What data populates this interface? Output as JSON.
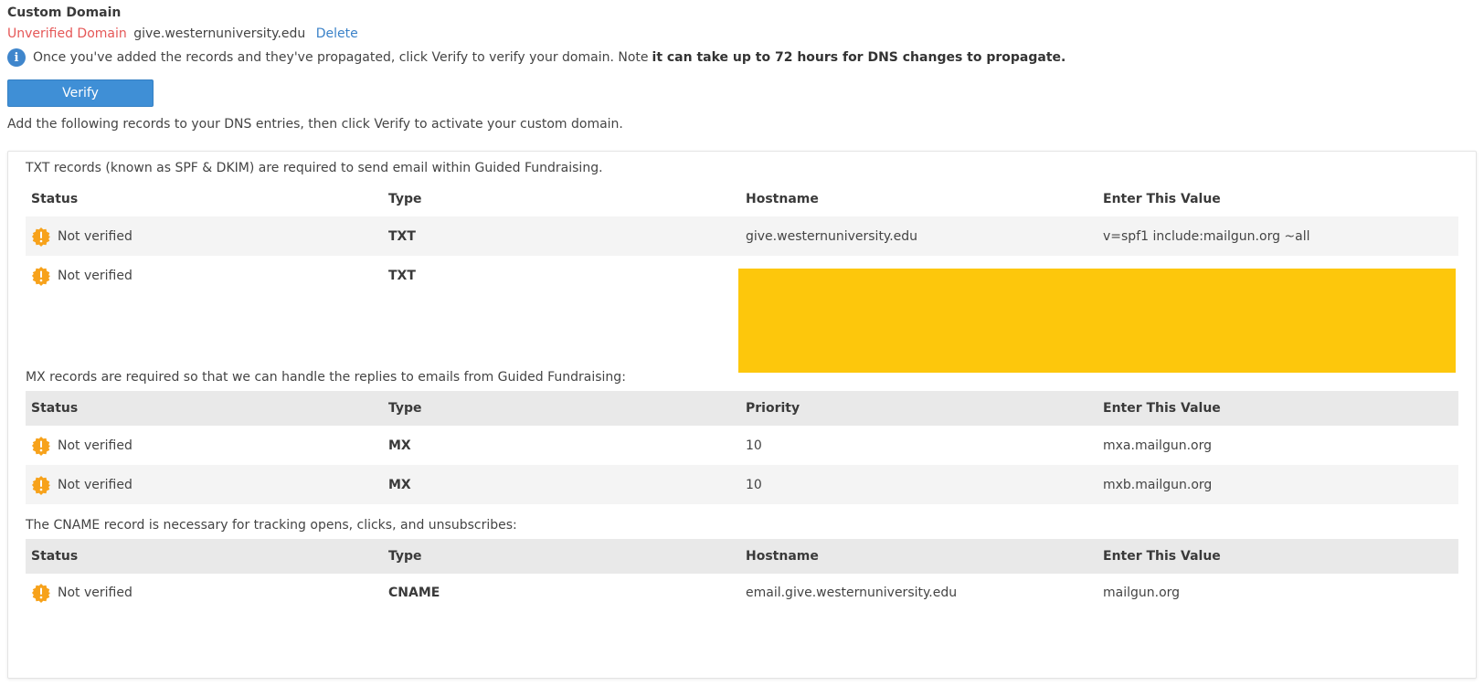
{
  "header": {
    "title": "Custom Domain",
    "status_label": "Unverified Domain",
    "domain": "give.westernuniversity.edu",
    "delete_label": "Delete"
  },
  "info": {
    "icon": "info-icon",
    "text": "Once you've added the records and they've propagated, click Verify to verify your domain. Note",
    "bold_text": "it can take up to 72 hours for DNS changes to propagate."
  },
  "verify_button": {
    "label": "Verify"
  },
  "instructions": "Add the following records to your DNS entries, then click Verify to activate your custom domain.",
  "colors": {
    "unverified": "#e55757",
    "link": "#3b82c8",
    "button": "#3f8fd6",
    "warning": "#f7a21b",
    "redaction": "#fdc70c"
  },
  "txt_section": {
    "note": "TXT records (known as SPF & DKIM) are required to send email within Guided Fundraising.",
    "headers": [
      "Status",
      "Type",
      "Hostname",
      "Enter This Value"
    ],
    "rows": [
      {
        "status": "Not verified",
        "type": "TXT",
        "hostname": "give.westernuniversity.edu",
        "value": "v=spf1 include:mailgun.org ~all"
      },
      {
        "status": "Not verified",
        "type": "TXT",
        "hostname": "",
        "value": ""
      }
    ]
  },
  "mx_section": {
    "note": "MX records are required so that we can handle the replies to emails from Guided Fundraising:",
    "headers": [
      "Status",
      "Type",
      "Priority",
      "Enter This Value"
    ],
    "rows": [
      {
        "status": "Not verified",
        "type": "MX",
        "priority": "10",
        "value": "mxa.mailgun.org"
      },
      {
        "status": "Not verified",
        "type": "MX",
        "priority": "10",
        "value": "mxb.mailgun.org"
      }
    ]
  },
  "cname_section": {
    "note": "The CNAME record is necessary for tracking opens, clicks, and unsubscribes:",
    "headers": [
      "Status",
      "Type",
      "Hostname",
      "Enter This Value"
    ],
    "rows": [
      {
        "status": "Not verified",
        "type": "CNAME",
        "hostname": "email.give.westernuniversity.edu",
        "value": "mailgun.org"
      }
    ]
  }
}
